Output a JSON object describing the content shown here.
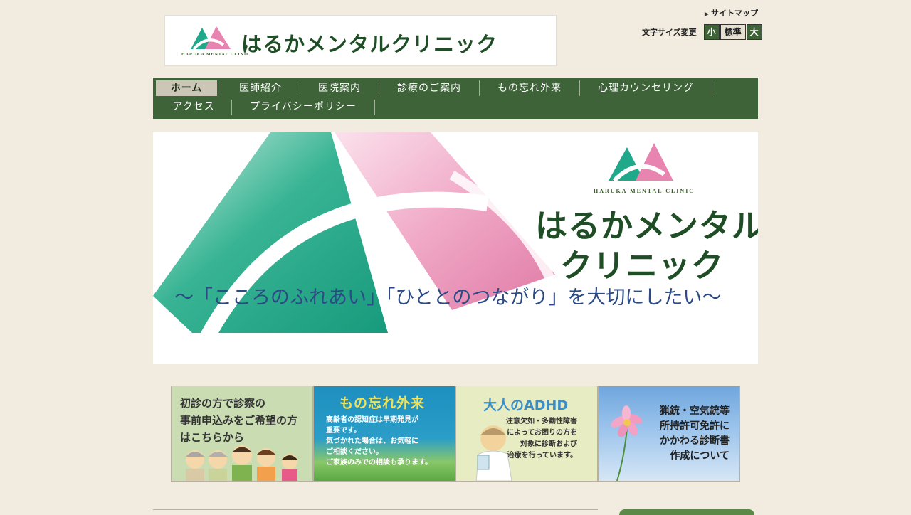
{
  "header": {
    "logo_name": "はるかメンタルクリニック",
    "logo_sub": "HARUKA MENTAL CLINIC",
    "sitemap": "サイトマップ",
    "fontsize_label": "文字サイズ変更",
    "fontsize_small": "小",
    "fontsize_standard": "標準",
    "fontsize_large": "大"
  },
  "nav": {
    "items": [
      {
        "label": "ホーム"
      },
      {
        "label": "医師紹介"
      },
      {
        "label": "医院案内"
      },
      {
        "label": "診療のご案内"
      },
      {
        "label": "もの忘れ外来"
      },
      {
        "label": "心理カウンセリング"
      },
      {
        "label": "アクセス"
      },
      {
        "label": "プライバシーポリシー"
      }
    ]
  },
  "hero": {
    "logo_sub": "HARUKA MENTAL CLINIC",
    "name_line1": "はるかメンタル",
    "name_line2": "クリニック",
    "tagline": "～「こころのふれあい」「ひととのつながり」を大切にしたい～"
  },
  "banners": {
    "first_visit": "初診の方で診察の\n事前申込みをご希望の方\nはこちらから",
    "memory_title": "もの忘れ外来",
    "memory_text": "高齢者の認知症は早期発見が\n重要です。\n気づかれた場合は、お気軽に\nご相談ください。\nご家族のみでの相談も承ります。",
    "adhd_title": "大人のADHD",
    "adhd_text": "注意欠如・多動性障害\nによってお困りの方を\n対象に診断および\n治療を行っています。",
    "gun_text": "猟銃・空気銃等\n所持許可免許に\nかかわる診断書\n作成について"
  },
  "colors": {
    "background": "#f2ebe0",
    "nav_green": "#3e6338",
    "brand_green": "#1f4d25",
    "teal": "#1fa88a",
    "pink": "#e884b0"
  }
}
